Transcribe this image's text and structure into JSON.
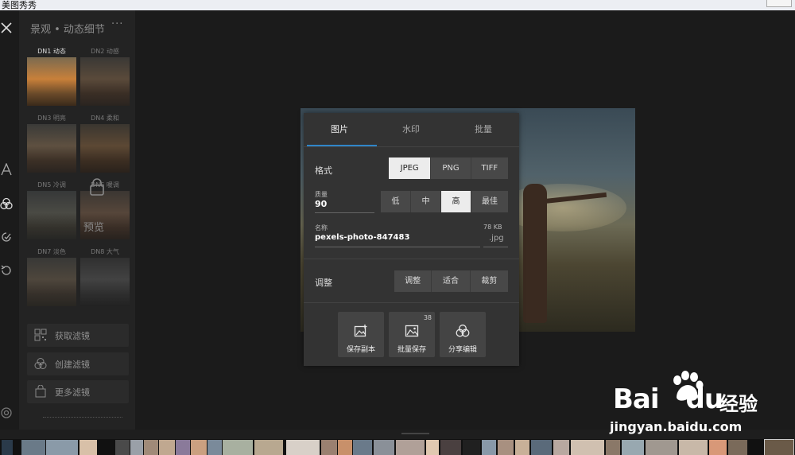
{
  "app": {
    "window_title": "美图秀秀"
  },
  "panel": {
    "title": "景观 • 动态细节",
    "more": "···",
    "filters": [
      {
        "label": "DN1 动态",
        "active": true
      },
      {
        "label": "DN2 动感",
        "active": false
      },
      {
        "label": "DN3 明亮",
        "active": false
      },
      {
        "label": "DN4 柔和",
        "active": false
      },
      {
        "label": "DN5 冷调",
        "active": false
      },
      {
        "label": "DN6 暖调",
        "active": false
      },
      {
        "label": "DN7 淡色",
        "active": false
      },
      {
        "label": "DN8 大气",
        "active": false
      }
    ],
    "preview_overlay": "预览",
    "buttons": [
      {
        "label": "获取滤镜",
        "icon": "qr-icon"
      },
      {
        "label": "创建滤镜",
        "icon": "filter-icon"
      },
      {
        "label": "更多滤镜",
        "icon": "bag-icon"
      }
    ]
  },
  "dialog": {
    "tabs": [
      "图片",
      "水印",
      "批量"
    ],
    "active_tab": 0,
    "format": {
      "label": "格式",
      "options": [
        "JPEG",
        "PNG",
        "TIFF"
      ],
      "selected": "JPEG"
    },
    "quality": {
      "label": "质量",
      "value": "90",
      "options": [
        "低",
        "中",
        "高",
        "最佳"
      ],
      "selected": "高"
    },
    "name": {
      "label": "名称",
      "value": "pexels-photo-847483",
      "size": "78 KB",
      "ext": ".jpg"
    },
    "adjust": {
      "label": "调整",
      "options": [
        "调整",
        "适合",
        "裁剪"
      ]
    },
    "actions": [
      {
        "label": "保存副本",
        "icon": "save-copy-icon",
        "badge": ""
      },
      {
        "label": "批量保存",
        "icon": "image-icon",
        "badge": "38"
      },
      {
        "label": "分享编辑",
        "icon": "share-icon",
        "badge": ""
      }
    ]
  },
  "watermark": {
    "brand": "Bai",
    "brand_du": "du",
    "brand_cn": "经验",
    "url": "jingyan.baidu.com"
  },
  "colors": {
    "accent": "#2f86c9",
    "dialog_bg": "#333333",
    "selected_bg": "#ececec"
  }
}
